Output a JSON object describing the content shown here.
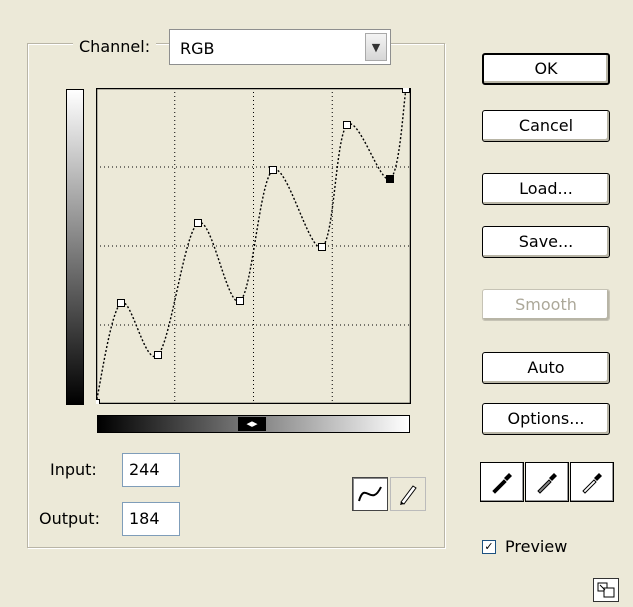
{
  "channel": {
    "label": "Channel:",
    "selected": "RGB"
  },
  "input": {
    "label": "Input:",
    "value": "244"
  },
  "output": {
    "label": "Output:",
    "value": "184"
  },
  "buttons": {
    "ok": "OK",
    "cancel": "Cancel",
    "load": "Load...",
    "save": "Save...",
    "smooth": "Smooth",
    "auto": "Auto",
    "options": "Options..."
  },
  "preview": {
    "label": "Preview",
    "checked": true
  },
  "curve": {
    "grid_divisions": 4,
    "control_points": [
      [
        0,
        0
      ],
      [
        25,
        100
      ],
      [
        62,
        48
      ],
      [
        102,
        180
      ],
      [
        144,
        102
      ],
      [
        177,
        233
      ],
      [
        226,
        156
      ],
      [
        251,
        278
      ],
      [
        294,
        224
      ],
      [
        310,
        314
      ]
    ],
    "selected_point_index": 8
  },
  "tools": [
    "curve-tool",
    "pencil-tool"
  ],
  "eyedroppers": [
    "black-point-eyedropper",
    "gray-point-eyedropper",
    "white-point-eyedropper"
  ]
}
